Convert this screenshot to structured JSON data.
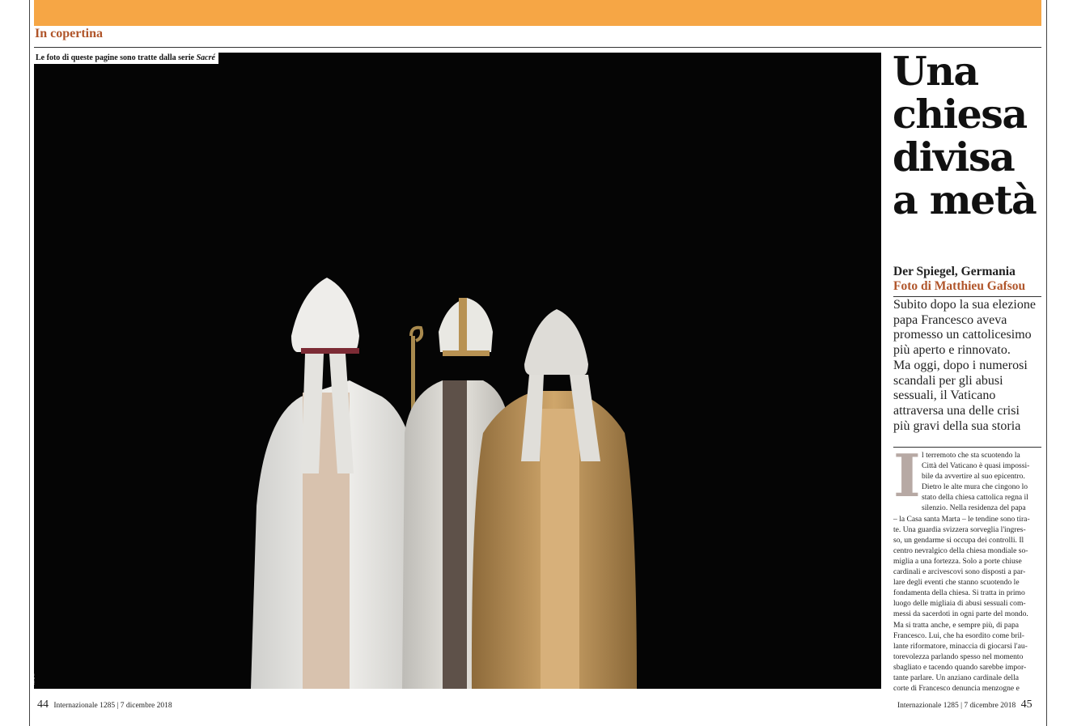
{
  "section_label": "In copertina",
  "photo": {
    "caption_text": "Le foto di queste pagine sono tratte dalla serie ",
    "caption_series": "Sacré",
    "side_id": "MAPS"
  },
  "headline": [
    "Una",
    "chiesa",
    "divisa",
    "a metà"
  ],
  "source": "Der Spiegel, Germania",
  "photographer": "Foto di Matthieu Gafsou",
  "intro": [
    "Subito dopo la sua elezione",
    "papa Francesco aveva",
    "promesso un cattolicesimo",
    "più aperto e rinnovato.",
    "Ma oggi, dopo i numerosi",
    "scandali per gli abusi",
    "sessuali, il Vaticano",
    "attraversa una delle crisi",
    "più gravi della sua storia"
  ],
  "body": {
    "dropcap": "I",
    "lines": [
      "l terremoto che sta scuotendo la",
      "Città del Vaticano è quasi impossi-",
      "bile da avvertire al suo epicentro.",
      "Dietro le alte mura che cingono lo",
      "stato della chiesa cattolica regna il",
      "silenzio. Nella residenza del papa",
      "– la Casa santa Marta – le tendine sono tira-",
      "te. Una guardia svizzera sorveglia l'ingres-",
      "so, un gendarme si occupa dei controlli. Il",
      "centro nevralgico della chiesa mondiale so-",
      "miglia a una fortezza. Solo a porte chiuse",
      "cardinali e arcivescovi sono disposti a par-",
      "lare degli eventi che stanno scuotendo le",
      "fondamenta della chiesa. Si tratta in primo",
      "luogo delle migliaia di abusi sessuali com-",
      "messi da sacerdoti in ogni parte del mondo.",
      "Ma si tratta anche, e sempre più, di papa",
      "Francesco. Lui, che ha esordito come bril-",
      "lante riformatore, minaccia di giocarsi l'au-",
      "torevolezza parlando spesso nel momento",
      "sbagliato e tacendo quando sarebbe impor-",
      "tante parlare. Un anziano cardinale della",
      "corte di Francesco denuncia menzogne e"
    ]
  },
  "footer": {
    "left_page": "44",
    "right_page": "45",
    "magazine": "Internazionale 1285",
    "separator": "|",
    "date": "7 dicembre 2018"
  }
}
